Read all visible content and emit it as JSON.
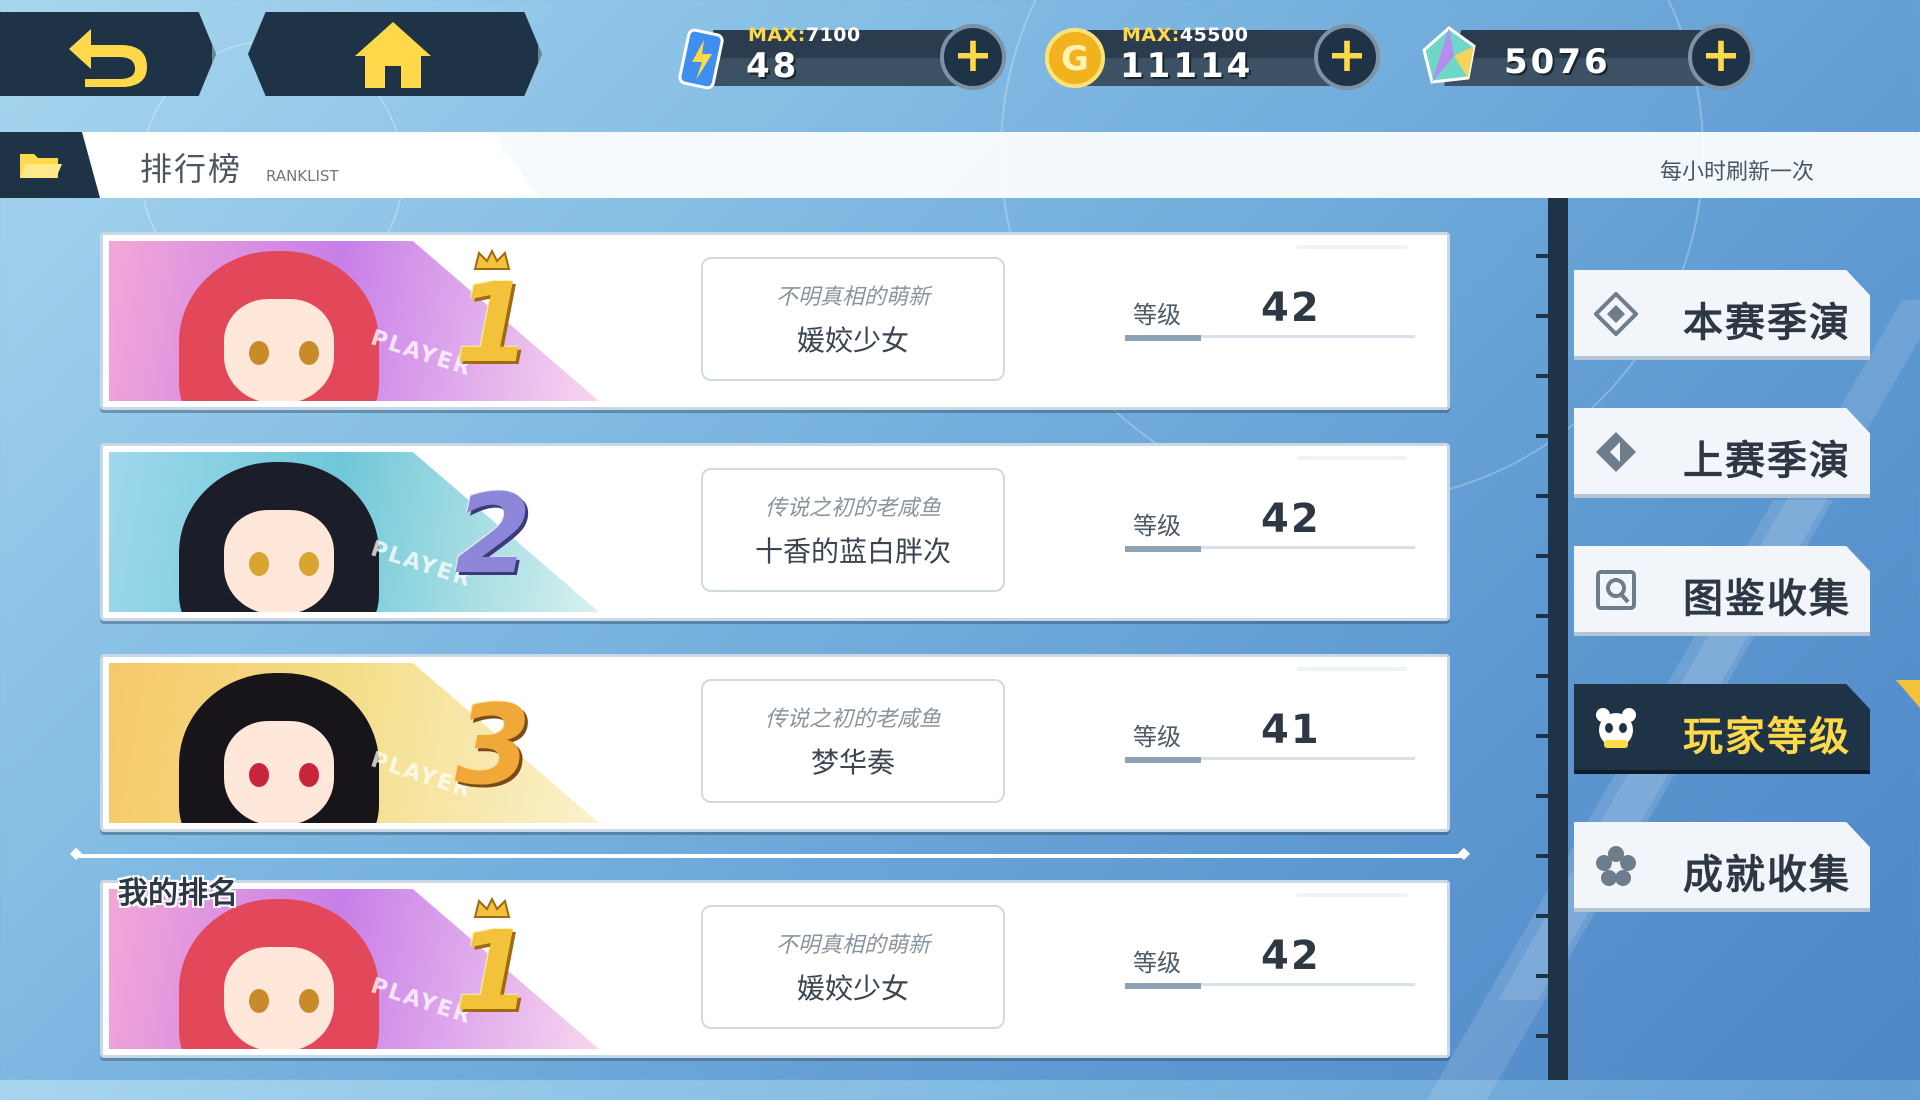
{
  "resources": [
    {
      "id": "energy",
      "icon": "energy-battery-icon",
      "max_label": "MAX:",
      "max_value": "7100",
      "value": "48"
    },
    {
      "id": "gold",
      "icon": "gold-coin-icon",
      "max_label": "MAX:",
      "max_value": "45500",
      "value": "11114"
    },
    {
      "id": "crystal",
      "icon": "crystal-gem-icon",
      "max_label": "",
      "max_value": "",
      "value": "5076"
    }
  ],
  "header": {
    "title": "排行榜",
    "subtitle": "RANKLIST",
    "refresh_note": "每小时刷新一次"
  },
  "ranks": [
    {
      "rank": "1",
      "title": "不明真相的萌新",
      "name": "媛姣少女",
      "level_label": "等级",
      "level": "42",
      "watermark": "PLAYER"
    },
    {
      "rank": "2",
      "title": "传说之初的老咸鱼",
      "name": "十香的蓝白胖次",
      "level_label": "等级",
      "level": "42",
      "watermark": "PLAYER"
    },
    {
      "rank": "3",
      "title": "传说之初的老咸鱼",
      "name": "梦华奏",
      "level_label": "等级",
      "level": "41",
      "watermark": "PLAYER"
    }
  ],
  "my_rank": {
    "label": "我的排名",
    "rank": "1",
    "title": "不明真相的萌新",
    "name": "媛姣少女",
    "level_label": "等级",
    "level": "42",
    "watermark": "PLAYER"
  },
  "side_menu": [
    {
      "label": "本赛季演武",
      "icon": "target-diamond-icon",
      "active": false
    },
    {
      "label": "上赛季演武",
      "icon": "back-diamond-icon",
      "active": false
    },
    {
      "label": "图鉴收集",
      "icon": "book-search-icon",
      "active": false
    },
    {
      "label": "玩家等级",
      "icon": "panda-icon",
      "active": true
    },
    {
      "label": "成就收集",
      "icon": "flower-icon",
      "active": false
    }
  ],
  "colors": {
    "accent": "#ffd94a",
    "dark": "#1f3346",
    "gold": "#f2c23a",
    "silver": "#8c87d8",
    "bronze": "#f0a838"
  }
}
